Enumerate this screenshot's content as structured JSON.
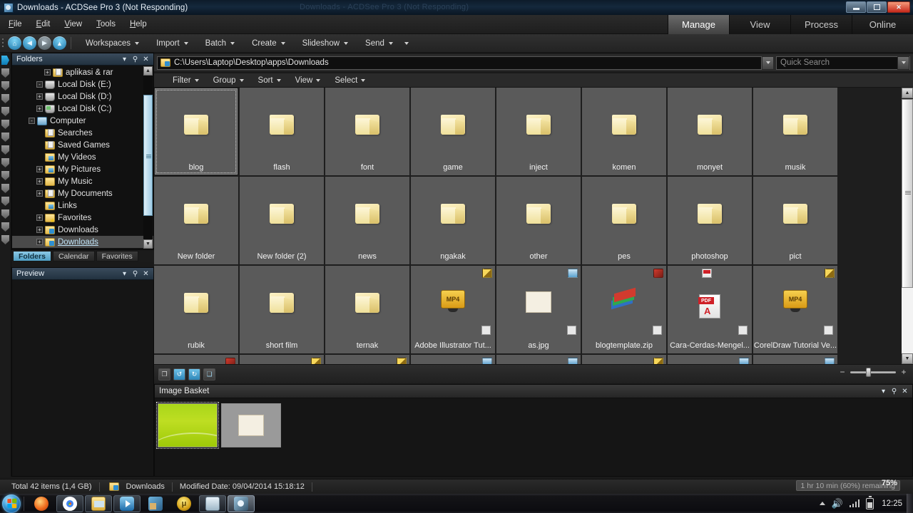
{
  "window": {
    "title": "Downloads - ACDSee Pro 3 (Not Responding)",
    "ghost_title": "Downloads - ACDSee Pro 3 (Not Responding)",
    "minimize": "—",
    "maximize": "□",
    "close": "✕"
  },
  "menubar": {
    "items": [
      {
        "label": "File",
        "accel": "F"
      },
      {
        "label": "Edit",
        "accel": "E"
      },
      {
        "label": "View",
        "accel": "V"
      },
      {
        "label": "Tools",
        "accel": "T"
      },
      {
        "label": "Help",
        "accel": "H"
      }
    ]
  },
  "mode_tabs": [
    {
      "label": "Manage",
      "active": true
    },
    {
      "label": "View",
      "active": false
    },
    {
      "label": "Process",
      "active": false
    },
    {
      "label": "Online",
      "active": false
    }
  ],
  "toolbar": {
    "nav": [
      {
        "name": "home-icon",
        "glyph": "⌂"
      },
      {
        "name": "back-icon",
        "glyph": "◀"
      },
      {
        "name": "forward-icon",
        "glyph": "▶"
      },
      {
        "name": "up-icon",
        "glyph": "▲"
      }
    ],
    "items": [
      {
        "label": "Workspaces"
      },
      {
        "label": "Import"
      },
      {
        "label": "Batch"
      },
      {
        "label": "Create"
      },
      {
        "label": "Slideshow"
      },
      {
        "label": "Send"
      }
    ],
    "overflow": "▾"
  },
  "folders_panel": {
    "title": "Folders",
    "collapse": "▾",
    "pin": "⚲",
    "close": "✕",
    "tree": [
      {
        "label": "Downloads",
        "indent": 2,
        "expander": "+",
        "icon": "folder-download",
        "selected": true
      },
      {
        "label": "Downloads",
        "indent": 2,
        "expander": "+",
        "icon": "folder-download",
        "selected": false
      },
      {
        "label": "Favorites",
        "indent": 2,
        "expander": "+",
        "icon": "folder-star",
        "selected": false
      },
      {
        "label": "Links",
        "indent": 2,
        "expander": "",
        "icon": "folder-links",
        "selected": false
      },
      {
        "label": "My Documents",
        "indent": 2,
        "expander": "+",
        "icon": "folder-doc",
        "selected": false
      },
      {
        "label": "My Music",
        "indent": 2,
        "expander": "+",
        "icon": "folder-music",
        "selected": false
      },
      {
        "label": "My Pictures",
        "indent": 2,
        "expander": "+",
        "icon": "folder-picture",
        "selected": false
      },
      {
        "label": "My Videos",
        "indent": 2,
        "expander": "",
        "icon": "folder-video",
        "selected": false
      },
      {
        "label": "Saved Games",
        "indent": 2,
        "expander": "",
        "icon": "folder-games",
        "selected": false
      },
      {
        "label": "Searches",
        "indent": 2,
        "expander": "",
        "icon": "folder-search",
        "selected": false
      },
      {
        "label": "Computer",
        "indent": 1,
        "expander": "-",
        "icon": "computer",
        "selected": false
      },
      {
        "label": "Local Disk (C:)",
        "indent": 2,
        "expander": "+",
        "icon": "disk-system",
        "selected": false
      },
      {
        "label": "Local Disk (D:)",
        "indent": 2,
        "expander": "+",
        "icon": "disk",
        "selected": false
      },
      {
        "label": "Local Disk (E:)",
        "indent": 2,
        "expander": "-",
        "icon": "disk",
        "selected": false
      },
      {
        "label": "aplikasi & rar",
        "indent": 3,
        "expander": "+",
        "icon": "folder-app",
        "selected": false
      }
    ]
  },
  "panel_tabs": [
    {
      "label": "Folders",
      "active": true
    },
    {
      "label": "Calendar",
      "active": false
    },
    {
      "label": "Favorites",
      "active": false
    }
  ],
  "preview_panel": {
    "title": "Preview",
    "collapse": "▾",
    "pin": "⚲",
    "close": "✕"
  },
  "pathbar": {
    "path": "C:\\Users\\Laptop\\Desktop\\apps\\Downloads",
    "dropdown": "▾",
    "search_placeholder": "Quick Search",
    "search_dropdown": "▾"
  },
  "filterbar": {
    "items": [
      "Filter",
      "Group",
      "Sort",
      "View",
      "Select"
    ]
  },
  "file_grid": {
    "items": [
      {
        "name": "blog",
        "type": "folder",
        "selected": true,
        "badge": "",
        "checkbox": false
      },
      {
        "name": "flash",
        "type": "folder",
        "selected": false,
        "badge": "",
        "checkbox": false
      },
      {
        "name": "font",
        "type": "folder",
        "selected": false,
        "badge": "",
        "checkbox": false
      },
      {
        "name": "game",
        "type": "folder",
        "selected": false,
        "badge": "",
        "checkbox": false
      },
      {
        "name": "inject",
        "type": "folder",
        "selected": false,
        "badge": "",
        "checkbox": false
      },
      {
        "name": "komen",
        "type": "folder",
        "selected": false,
        "badge": "",
        "checkbox": false
      },
      {
        "name": "monyet",
        "type": "folder",
        "selected": false,
        "badge": "",
        "checkbox": false
      },
      {
        "name": "musik",
        "type": "folder",
        "selected": false,
        "badge": "",
        "checkbox": false
      },
      {
        "name": "New folder",
        "type": "folder",
        "selected": false,
        "badge": "",
        "checkbox": false
      },
      {
        "name": "New folder (2)",
        "type": "folder",
        "selected": false,
        "badge": "",
        "checkbox": false
      },
      {
        "name": "news",
        "type": "folder",
        "selected": false,
        "badge": "",
        "checkbox": false
      },
      {
        "name": "ngakak",
        "type": "folder",
        "selected": false,
        "badge": "",
        "checkbox": false
      },
      {
        "name": "other",
        "type": "folder",
        "selected": false,
        "badge": "",
        "checkbox": false
      },
      {
        "name": "pes",
        "type": "folder",
        "selected": false,
        "badge": "",
        "checkbox": false
      },
      {
        "name": "photoshop",
        "type": "folder",
        "selected": false,
        "badge": "",
        "checkbox": false
      },
      {
        "name": "pict",
        "type": "folder",
        "selected": false,
        "badge": "",
        "checkbox": false
      },
      {
        "name": "rubik",
        "type": "folder",
        "selected": false,
        "badge": "",
        "checkbox": false
      },
      {
        "name": "short film",
        "type": "folder",
        "selected": false,
        "badge": "",
        "checkbox": false
      },
      {
        "name": "ternak",
        "type": "folder",
        "selected": false,
        "badge": "",
        "checkbox": false
      },
      {
        "name": "Adobe Illustrator Tut...",
        "type": "mp4",
        "selected": false,
        "badge": "mp4",
        "checkbox": true
      },
      {
        "name": "as.jpg",
        "type": "image",
        "selected": false,
        "badge": "pic",
        "checkbox": true
      },
      {
        "name": "blogtemplate.zip",
        "type": "zip",
        "selected": false,
        "badge": "zip",
        "checkbox": true
      },
      {
        "name": "Cara-Cerdas-Mengel...",
        "type": "pdf",
        "selected": false,
        "badge": "pdf",
        "checkbox": true
      },
      {
        "name": "CorelDraw Tutorial Ve...",
        "type": "mp4",
        "selected": false,
        "badge": "mp4",
        "checkbox": true
      }
    ],
    "partial_row_badges": [
      "zip",
      "mp4",
      "mp4",
      "blue",
      "blue",
      "mp4",
      "blue",
      "blue"
    ]
  },
  "minibar": {
    "buttons": [
      {
        "name": "copy-to-basket-icon",
        "glyph": "❐"
      },
      {
        "name": "rotate-left-icon",
        "glyph": "↺"
      },
      {
        "name": "rotate-right-icon",
        "glyph": "↻"
      },
      {
        "name": "compare-icon",
        "glyph": "❏"
      }
    ]
  },
  "zoom_slider": {
    "minus": "−",
    "plus": "+"
  },
  "image_basket": {
    "title": "Image Basket",
    "collapse": "▾",
    "pin": "⚲",
    "close": "✕",
    "thumbs": [
      {
        "name": "green-gradient-thumbnail",
        "selected": true
      },
      {
        "name": "image-placeholder-thumbnail",
        "selected": false
      }
    ]
  },
  "statusbar": {
    "total": "Total 42 items  (1,4 GB)",
    "folder": "Downloads",
    "modified": "Modified Date: 09/04/2014 15:18:12",
    "battery_tooltip": "1 hr 10 min (60%) remaining",
    "percent": "75%"
  },
  "taskbar": {
    "start": "start-orb",
    "apps": [
      {
        "name": "firefox-icon",
        "state": "pinned"
      },
      {
        "name": "chrome-icon",
        "state": "open"
      },
      {
        "name": "explorer-icon",
        "state": "open"
      },
      {
        "name": "wmp-icon",
        "state": "open"
      },
      {
        "name": "office-icon",
        "state": "pinned"
      },
      {
        "name": "utorrent-icon",
        "state": "pinned",
        "glyph": "μ"
      },
      {
        "name": "notepad-icon",
        "state": "open"
      },
      {
        "name": "acdsee-icon",
        "state": "active"
      }
    ],
    "tray": {
      "show_hidden": "▲",
      "volume": "🔊",
      "network": "signal-bars",
      "battery": "battery-icon",
      "clock": "12:25"
    }
  },
  "colors": {
    "accent": "#4f9ec4",
    "title_blue": "#14283c",
    "grid_cell": "#5a5a5a",
    "panel_bg": "#111111",
    "close_red": "#c6281b"
  }
}
